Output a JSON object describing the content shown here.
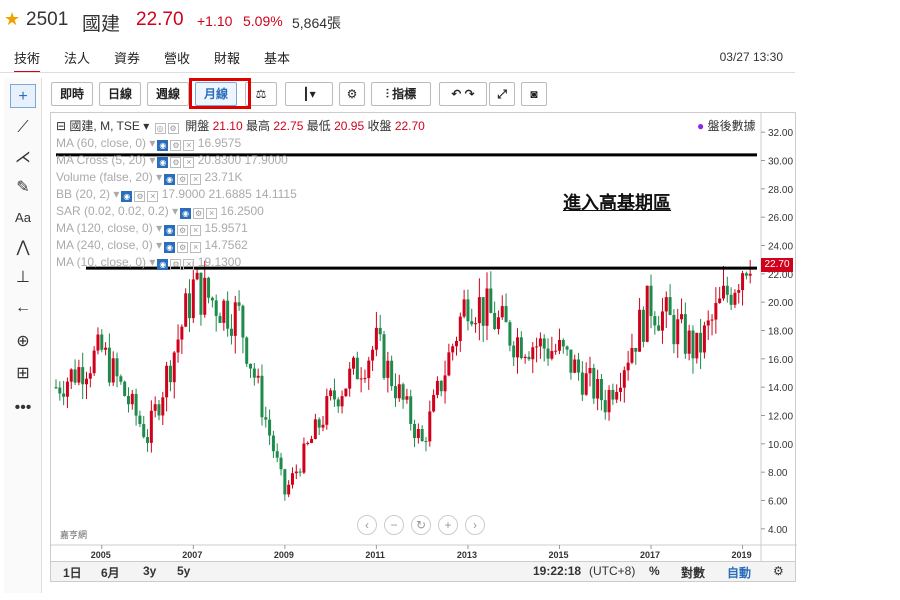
{
  "header": {
    "code": "2501",
    "name": "國建",
    "price": "22.70",
    "change": "+1.10",
    "percent": "5.09%",
    "volume": "5,864張",
    "datetime": "03/27 13:30"
  },
  "nav_tabs": [
    "技術",
    "法人",
    "資券",
    "營收",
    "財報",
    "基本"
  ],
  "toolbar": {
    "intraday": "即時",
    "daily": "日線",
    "weekly": "週線",
    "monthly": "月線",
    "indicators": "指標"
  },
  "legend": {
    "symbol": "國建, M, TSE",
    "open_label": "開盤",
    "open": "21.10",
    "high_label": "最高",
    "high": "22.75",
    "low_label": "最低",
    "low": "20.95",
    "close_label": "收盤",
    "close": "22.70",
    "after_hours": "盤後數據",
    "lines": [
      {
        "label": "MA (60, close, 0)",
        "value": "16.9575"
      },
      {
        "label": "MA Cross (5, 20)",
        "value": "20.8300  17.9000"
      },
      {
        "label": "Volume (false, 20)",
        "value": "23.71K"
      },
      {
        "label": "BB (20, 2)",
        "value": "17.9000  21.6885  14.1115"
      },
      {
        "label": "SAR (0.02, 0.02, 0.2)",
        "value": "16.2500"
      },
      {
        "label": "MA (120, close, 0)",
        "value": "15.9571"
      },
      {
        "label": "MA (240, close, 0)",
        "value": "14.7562"
      },
      {
        "label": "MA (10, close, 0)",
        "value": "19.1300"
      }
    ]
  },
  "annotation": "進入高基期區",
  "price_tag": "22.70",
  "y_ticks": [
    "32.00",
    "30.00",
    "28.00",
    "26.00",
    "24.00",
    "22.00",
    "20.00",
    "18.00",
    "16.00",
    "14.00",
    "12.00",
    "10.00",
    "8.00",
    "6.00",
    "4.00"
  ],
  "x_ticks": [
    "2005",
    "2007",
    "2009",
    "2011",
    "2013",
    "2015",
    "2017",
    "2019"
  ],
  "logo_text": "嘉亨網",
  "bottom": {
    "range_1d": "1日",
    "range_6m": "6月",
    "range_3y": "3y",
    "range_5y": "5y",
    "time": "19:22:18",
    "tz": "(UTC+8)",
    "pct": "%",
    "log": "對數",
    "auto": "自動"
  },
  "chart_data": {
    "type": "candlestick",
    "title": "國建, M, TSE",
    "x": [
      "2004",
      "2005",
      "2006",
      "2007",
      "2008",
      "2009",
      "2010",
      "2011",
      "2012",
      "2013",
      "2014",
      "2015",
      "2016",
      "2017",
      "2018",
      "2019"
    ],
    "close": [
      14.0,
      16.5,
      10.5,
      21.0,
      19.0,
      6.5,
      13.0,
      17.0,
      10.0,
      20.5,
      17.5,
      16.5,
      13.0,
      20.0,
      16.5,
      22.7
    ],
    "ylim": [
      3.0,
      33.0
    ],
    "horizontal_lines": [
      30.4,
      22.4
    ],
    "last_close": 22.7
  },
  "colors": {
    "up": "#d0021b",
    "down": "#1e8a4c",
    "accent": "#2a6ebb"
  }
}
